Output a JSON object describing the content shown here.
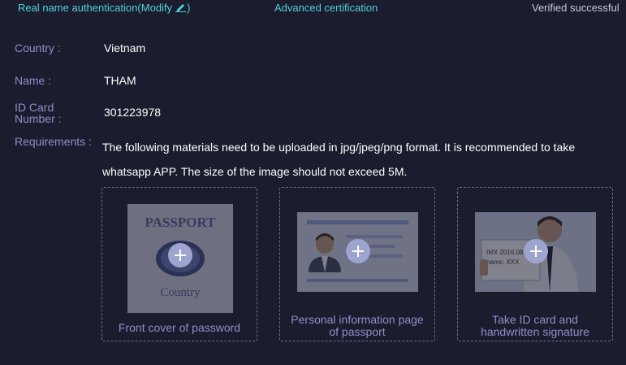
{
  "tabs": {
    "real_name": "Real name authentication(Modify",
    "real_name_close": ")",
    "advanced": "Advanced certification",
    "verified": "Verified successful"
  },
  "form": {
    "country_label": "Country :",
    "country_value": "Vietnam",
    "name_label": "Name :",
    "name_value": "THAM",
    "id_label_line1": "ID Card",
    "id_label_line2": "Number :",
    "id_value": "301223978",
    "requirements_label": "Requirements :",
    "requirements_line1": "The following materials need to be uploaded in jpg/jpeg/png format. It is recommended to take",
    "requirements_line2": "whatsapp APP. The size of the image should not exceed 5M."
  },
  "uploads": [
    {
      "caption": "Front cover of password",
      "thumb_text_top": "PASSPORT",
      "thumb_text_bottom": "Country"
    },
    {
      "caption_line1": "Personal information page",
      "caption_line2": "of passport"
    },
    {
      "caption_line1": "Take ID card and",
      "caption_line2": "handwritten signature",
      "thumb_text_1": "IMX 2016.08.04",
      "thumb_text_2": "name: XXX"
    }
  ],
  "colors": {
    "accent": "#4fd1d9",
    "label": "#8f8fc8",
    "background": "#1b1c2e"
  },
  "icons": {
    "modify": "pencil-icon",
    "upload": "plus-icon"
  }
}
